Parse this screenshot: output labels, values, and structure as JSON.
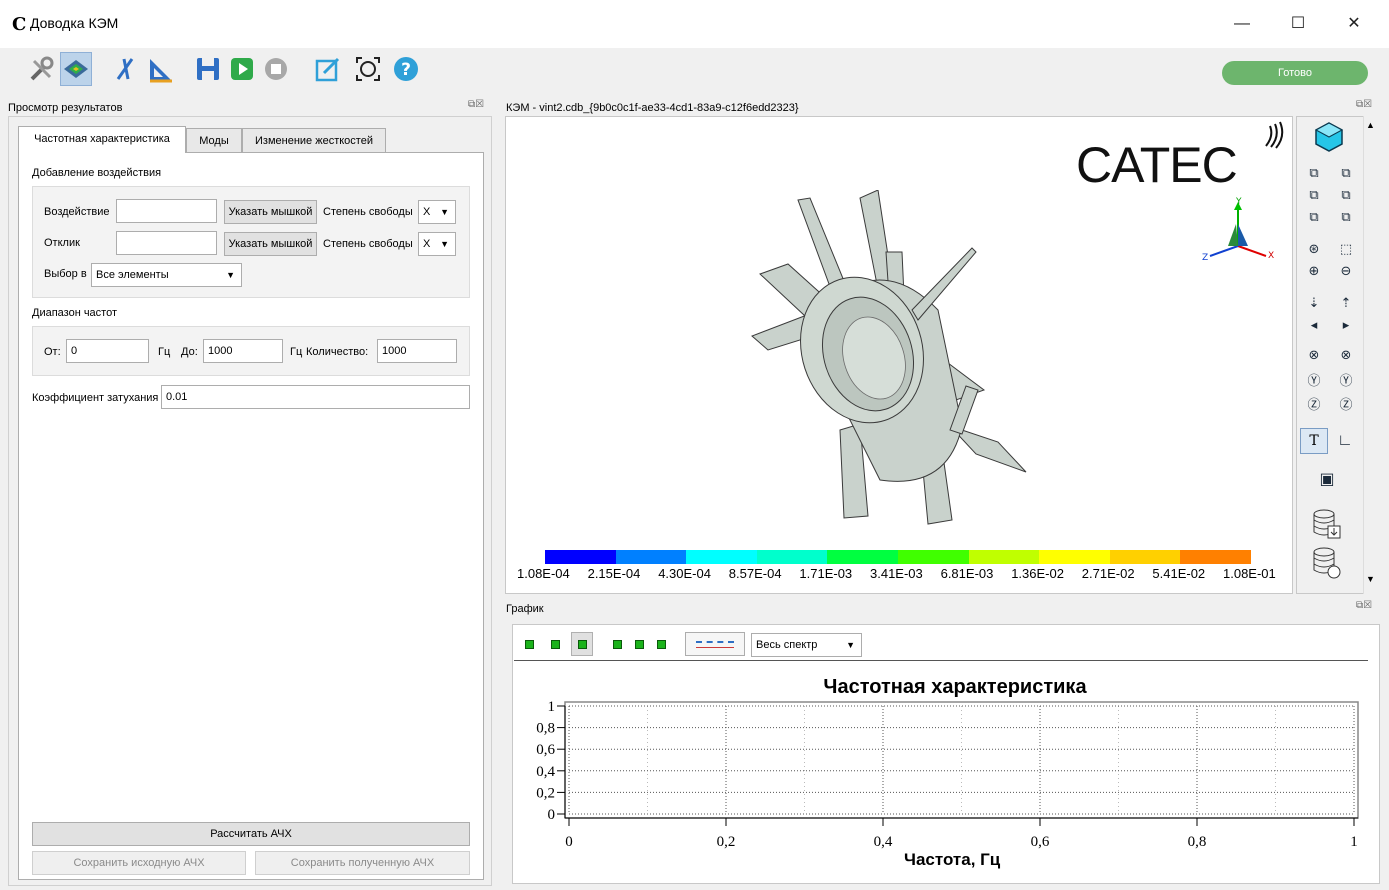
{
  "window": {
    "title": "Доводка КЭМ",
    "app_logo": "С",
    "minimize": "—",
    "maximize": "☐",
    "close": "✕"
  },
  "toolbar": {
    "icons": [
      "tools-icon",
      "results-view-icon",
      "cut-icon",
      "measure-icon",
      "save-icon",
      "run-icon",
      "stop-icon",
      "edit-icon",
      "target-icon",
      "help-icon"
    ],
    "status": "Готово",
    "colors": {
      "status": "#6db56d"
    }
  },
  "left_dock": {
    "title": "Просмотр результатов",
    "tabs": [
      "Частотная характеристика",
      "Моды",
      "Изменение жесткостей"
    ],
    "group_excitation": {
      "title": "Добавление воздействия",
      "impact_label": "Воздействие",
      "impact_value": "",
      "pick_button": "Указать мышкой",
      "dof_label": "Степень свободы",
      "dof_value": "X",
      "response_label": "Отклик",
      "response_value": "",
      "pick_button2": "Указать мышкой",
      "dof_label2": "Степень свободы",
      "dof_value2": "X",
      "select_label": "Выбор в",
      "select_value": "Все элементы"
    },
    "group_freq": {
      "title": "Диапазон частот",
      "from_label": "От:",
      "from_value": "0",
      "unit1": "Гц",
      "to_label": "До:",
      "to_value": "1000",
      "unit2": "Гц",
      "count_label": "Количество:",
      "count_value": "1000"
    },
    "damping_label": "Коэффициент затухания",
    "damping_value": "0.01",
    "calc_button": "Рассчитать АЧХ",
    "save_orig_button": "Сохранить исходную АЧХ",
    "save_result_button": "Сохранить полученную АЧХ"
  },
  "viewport": {
    "title": "КЭМ - vint2.cdb_{9b0c0c1f-ae33-4cd1-83a9-c12f6edd2323}",
    "logo": "CATEC",
    "axis_labels": {
      "x": "X",
      "y": "Y",
      "z": "Z"
    },
    "legend": {
      "colors": [
        "#0000ff",
        "#0080ff",
        "#00ffff",
        "#00ffcc",
        "#00ff40",
        "#40ff00",
        "#c0ff00",
        "#ffff00",
        "#ffd000",
        "#ff8000",
        "#ff0000"
      ],
      "labels": [
        "1.08E-04",
        "2.15E-04",
        "4.30E-04",
        "8.57E-04",
        "1.71E-03",
        "3.41E-03",
        "6.81E-03",
        "1.36E-02",
        "2.71E-02",
        "5.41E-02",
        "1.08E-01"
      ]
    }
  },
  "graph_dock": {
    "title": "График",
    "spectrum_select": "Весь спектр",
    "chart_data": {
      "type": "line",
      "title": "Частотная характеристика",
      "xlabel": "Частота, Гц",
      "ylabel": "",
      "xlim": [
        0,
        1
      ],
      "ylim": [
        0,
        1
      ],
      "xticks": [
        "0",
        "0,2",
        "0,4",
        "0,6",
        "0,8",
        "1"
      ],
      "yticks": [
        "0",
        "0,2",
        "0,4",
        "0,6",
        "0,8",
        "1"
      ],
      "series": [],
      "grid": true
    }
  }
}
